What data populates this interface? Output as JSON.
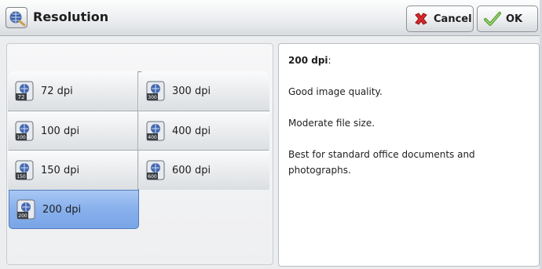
{
  "header": {
    "title": "Resolution",
    "cancel_label": "Cancel",
    "ok_label": "OK"
  },
  "options": [
    {
      "label": "72 dpi",
      "badge": "72"
    },
    {
      "label": "300 dpi",
      "badge": "300"
    },
    {
      "label": "100 dpi",
      "badge": "100"
    },
    {
      "label": "400 dpi",
      "badge": "400"
    },
    {
      "label": "150 dpi",
      "badge": "150"
    },
    {
      "label": "600 dpi",
      "badge": "600"
    },
    {
      "label": "200 dpi",
      "badge": "200"
    }
  ],
  "selected_option": "200 dpi",
  "info": {
    "title": "200 dpi",
    "title_suffix": ":",
    "line1": "Good image quality.",
    "line2": "Moderate file size.",
    "line3": "Best for standard office documents and photographs."
  },
  "colors": {
    "selected": "#87b0ec",
    "cancel_icon": "#d8282b",
    "ok_icon": "#5aa232"
  }
}
